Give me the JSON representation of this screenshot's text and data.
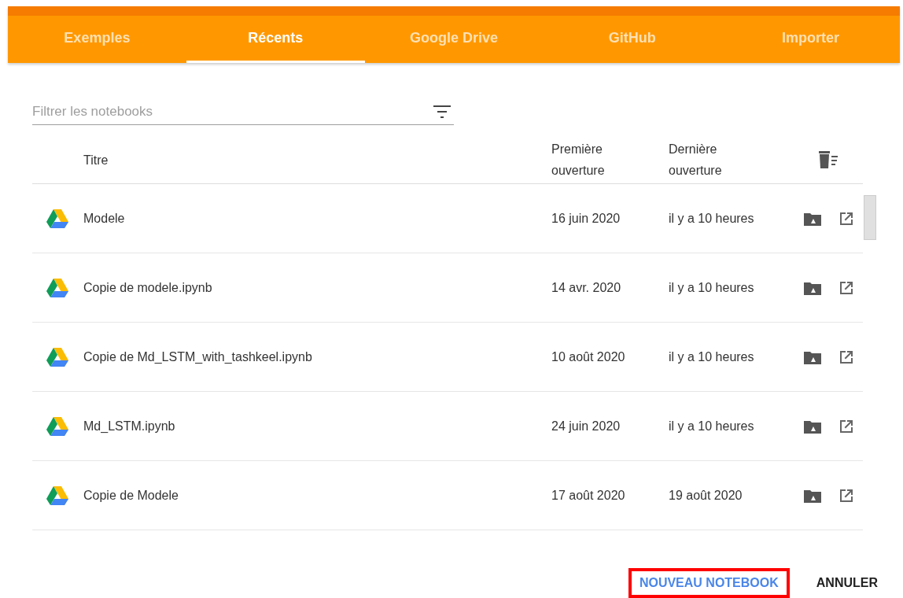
{
  "tabs": [
    {
      "label": "Exemples",
      "selected": false
    },
    {
      "label": "Récents",
      "selected": true
    },
    {
      "label": "Google Drive",
      "selected": false
    },
    {
      "label": "GitHub",
      "selected": false
    },
    {
      "label": "Importer",
      "selected": false
    }
  ],
  "filter": {
    "placeholder": "Filtrer les notebooks"
  },
  "table": {
    "columns": [
      "Titre",
      "Première ouverture",
      "Dernière ouverture"
    ],
    "rows": [
      {
        "title": "Modele",
        "first_opened": "16 juin 2020",
        "last_opened": "il y a 10 heures"
      },
      {
        "title": "Copie de modele.ipynb",
        "first_opened": "14 avr. 2020",
        "last_opened": "il y a 10 heures"
      },
      {
        "title": "Copie de Md_LSTM_with_tashkeel.ipynb",
        "first_opened": "10 août 2020",
        "last_opened": "il y a 10 heures"
      },
      {
        "title": "Md_LSTM.ipynb",
        "first_opened": "24 juin 2020",
        "last_opened": "il y a 10 heures"
      },
      {
        "title": "Copie de Modele",
        "first_opened": "17 août 2020",
        "last_opened": "19 août 2020"
      }
    ]
  },
  "buttons": [
    {
      "label": "NOUVEAU NOTEBOOK",
      "kind": "primary",
      "highlighted": true
    },
    {
      "label": "ANNULER",
      "kind": "plain",
      "highlighted": false
    }
  ]
}
